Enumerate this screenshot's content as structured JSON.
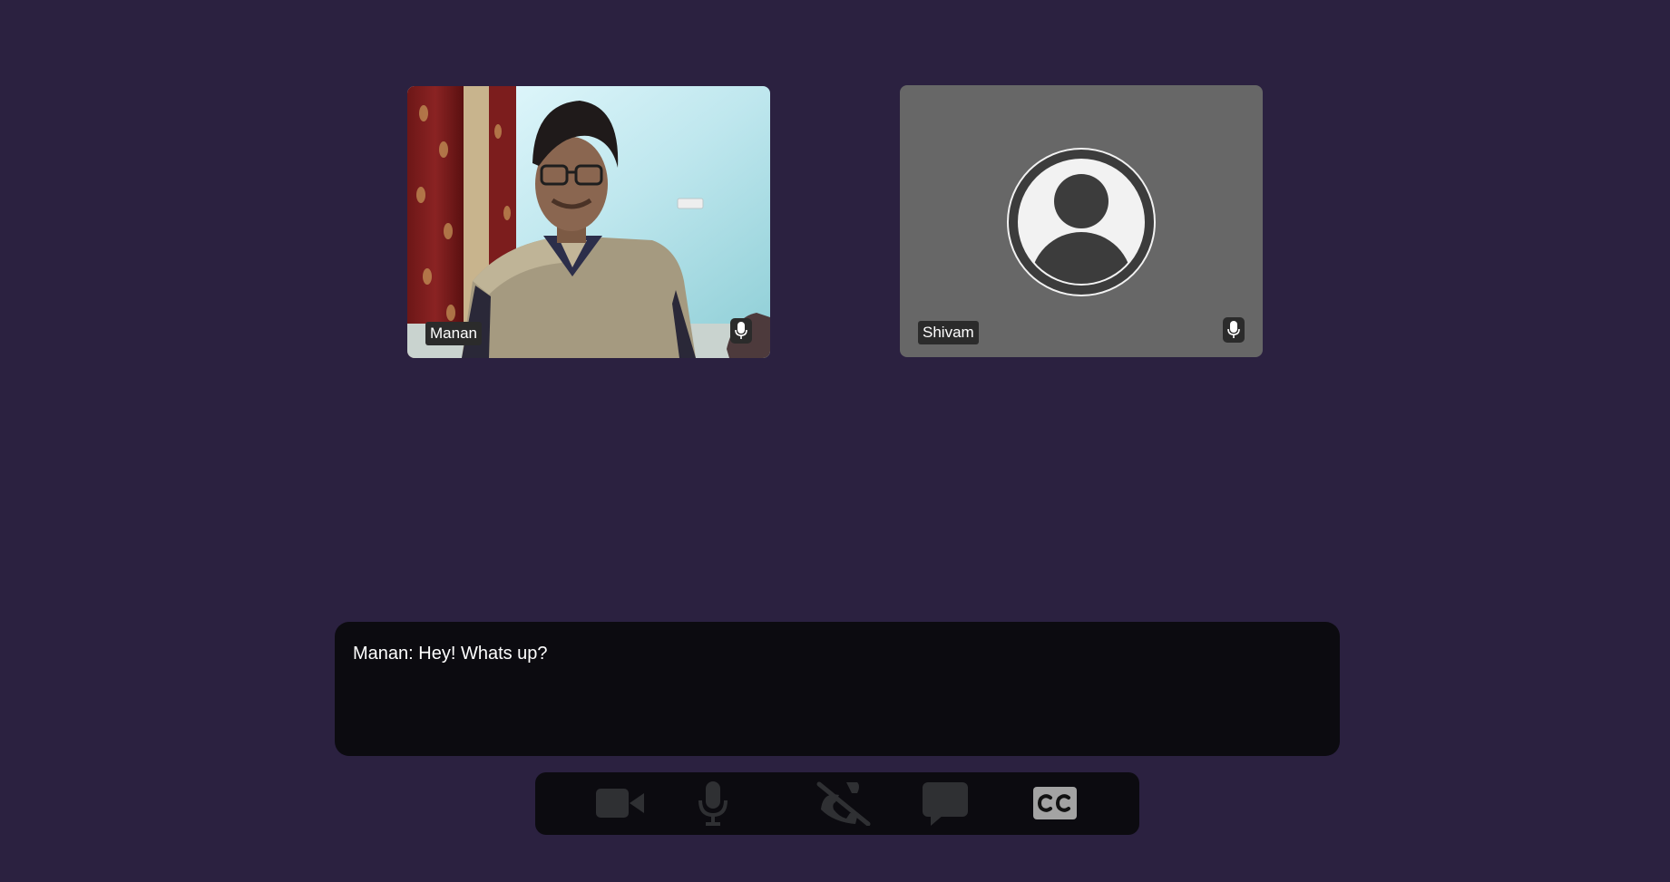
{
  "participants": [
    {
      "name": "Manan",
      "video": "on",
      "mic_icon": "microphone-icon"
    },
    {
      "name": "Shivam",
      "video": "off",
      "avatar_icon": "user-avatar-icon",
      "mic_icon": "microphone-icon"
    }
  ],
  "captions": {
    "text": "Manan: Hey! Whats up?"
  },
  "controls": [
    {
      "icon": "video-camera-icon",
      "state": "active"
    },
    {
      "icon": "microphone-icon",
      "state": "active"
    },
    {
      "icon": "hang-up-icon",
      "state": "active"
    },
    {
      "icon": "chat-icon",
      "state": "active"
    },
    {
      "icon": "closed-captions-icon",
      "state": "on"
    }
  ],
  "colors": {
    "background": "#2b2140",
    "panel": "#0c0b10",
    "icon_muted": "#2f3033",
    "cc_badge": "#a3a3a3",
    "tile_placeholder": "#676767"
  }
}
